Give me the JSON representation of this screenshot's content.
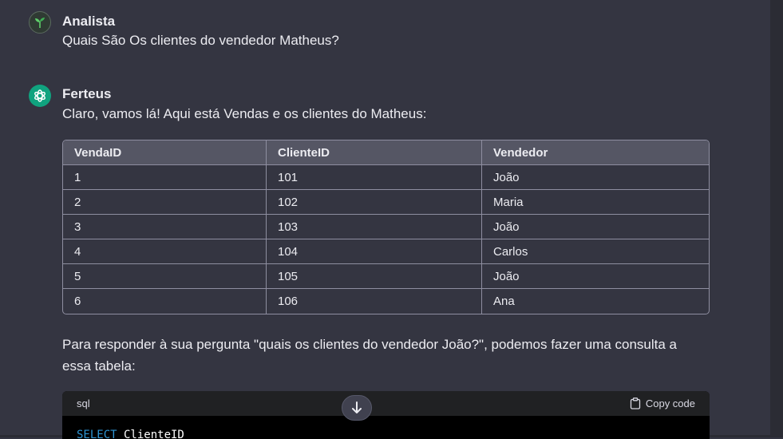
{
  "user": {
    "name": "Analista",
    "message": "Quais São Os clientes do vendedor Matheus?"
  },
  "assistant": {
    "name": "Ferteus",
    "intro": "Claro, vamos lá! Aqui está Vendas e os clientes do Matheus:",
    "table": {
      "headers": [
        "VendaID",
        "ClienteID",
        "Vendedor"
      ],
      "rows": [
        [
          "1",
          "101",
          "João"
        ],
        [
          "2",
          "102",
          "Maria"
        ],
        [
          "3",
          "103",
          "João"
        ],
        [
          "4",
          "104",
          "Carlos"
        ],
        [
          "5",
          "105",
          "João"
        ],
        [
          "6",
          "106",
          "Ana"
        ]
      ]
    },
    "paragraph": "Para responder à sua pergunta \"quais os clientes do vendedor João?\", podemos fazer uma consulta a essa tabela:",
    "code": {
      "language": "sql",
      "copy_label": "Copy code",
      "keyword": "SELECT",
      "rest": " ClienteID"
    }
  },
  "icons": {
    "user_avatar": "sprout-icon",
    "assistant_avatar": "openai-logo-icon",
    "copy": "clipboard-icon",
    "scroll": "arrow-down-icon"
  },
  "colors": {
    "background": "#343541",
    "accent": "#10a37f",
    "code_keyword": "#2e95d3"
  }
}
